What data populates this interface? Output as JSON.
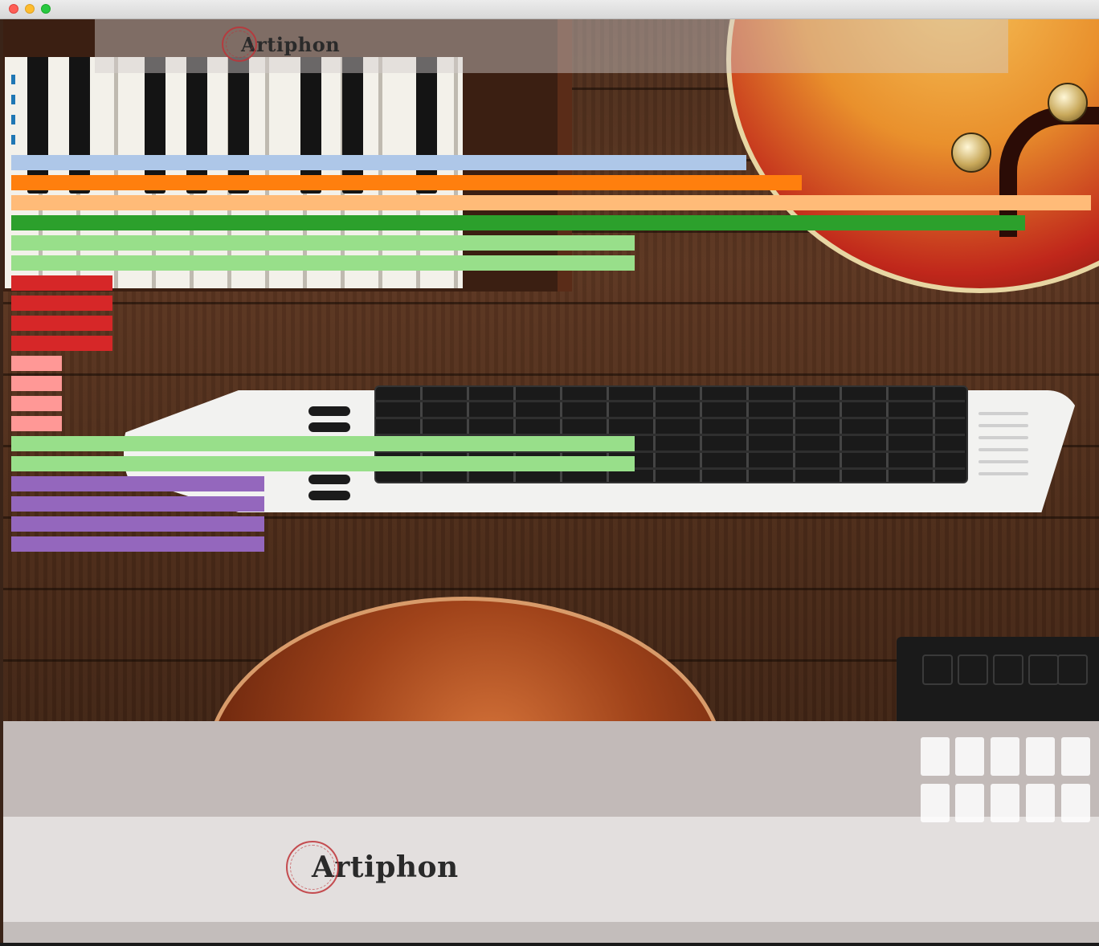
{
  "window": {
    "controls": [
      "close",
      "minimize",
      "maximize"
    ]
  },
  "header": {
    "logo_text": "Artiphon"
  },
  "footer": {
    "logo_text": "Artiphon"
  },
  "colors": {
    "blue_marker": "#1f77b4",
    "light_blue": "#aec7e8",
    "orange": "#ff7f0e",
    "light_orange": "#ffbb78",
    "green": "#2ca02c",
    "light_green": "#98df8a",
    "red": "#d62728",
    "pink": "#ff9896",
    "purple": "#9467bd"
  },
  "bars": [
    {
      "color": "#aec7e8"
    },
    {
      "color": "#ff7f0e"
    },
    {
      "color": "#ffbb78"
    },
    {
      "color": "#2ca02c"
    },
    {
      "color": "#98df8a"
    },
    {
      "color": "#98df8a"
    },
    {
      "color": "#d62728"
    },
    {
      "color": "#d62728"
    },
    {
      "color": "#d62728"
    },
    {
      "color": "#d62728"
    },
    {
      "color": "#ff9896"
    },
    {
      "color": "#ff9896"
    },
    {
      "color": "#ff9896"
    },
    {
      "color": "#ff9896"
    },
    {
      "color": "#98df8a"
    },
    {
      "color": "#98df8a"
    },
    {
      "color": "#9467bd"
    },
    {
      "color": "#9467bd"
    },
    {
      "color": "#9467bd"
    },
    {
      "color": "#9467bd"
    }
  ]
}
